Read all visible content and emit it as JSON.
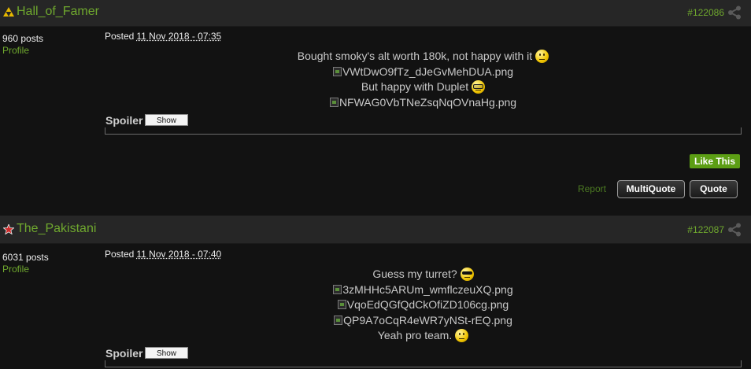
{
  "posts": [
    {
      "username": "Hall_of_Famer",
      "post_number": "#122086",
      "post_count": "960 posts",
      "profile_label": "Profile",
      "posted_label": "Posted",
      "posted_date": "11 Nov 2018 - 07:35",
      "lines": [
        {
          "type": "text",
          "text": "Bought smoky's alt worth 180k, not happy with it",
          "smiley": "smile"
        },
        {
          "type": "image",
          "text": "VWtDwO9fTz_dJeGvMehDUA.png"
        },
        {
          "type": "text",
          "text": "But happy with Duplet",
          "smiley": "glasses"
        },
        {
          "type": "image",
          "text": "NFWAG0VbTNeZsqNqOVnaHg.png"
        }
      ],
      "spoiler_label": "Spoiler",
      "spoiler_button": "Show",
      "like_label": "Like This",
      "report_label": "Report",
      "multiquote_label": "MultiQuote",
      "quote_label": "Quote"
    },
    {
      "username": "The_Pakistani",
      "post_number": "#122087",
      "post_count": "6031 posts",
      "profile_label": "Profile",
      "posted_label": "Posted",
      "posted_date": "11 Nov 2018 - 07:40",
      "lines": [
        {
          "type": "text",
          "text": "Guess my turret?",
          "smiley": "shades"
        },
        {
          "type": "image",
          "text": "3zMHHc5ARUm_wmflczeuXQ.png"
        },
        {
          "type": "image",
          "text": "VqoEdQGfQdCkOfiZD106cg.png"
        },
        {
          "type": "image",
          "text": "QP9A7oCqR4eWR7yNSt-rEQ.png"
        },
        {
          "type": "text",
          "text": "Yeah pro team.",
          "smiley": "smile"
        }
      ],
      "spoiler_label": "Spoiler",
      "spoiler_button": "Show"
    }
  ],
  "colors": {
    "accent_green": "#6fa82e",
    "like_green": "#5c9e14",
    "header_bg": "#262626",
    "body_bg": "#121212"
  },
  "icons": {
    "rank_icon_1": "gold-triforce-rank-icon",
    "rank_icon_2": "red-star-rank-icon",
    "share": "share-icon"
  }
}
